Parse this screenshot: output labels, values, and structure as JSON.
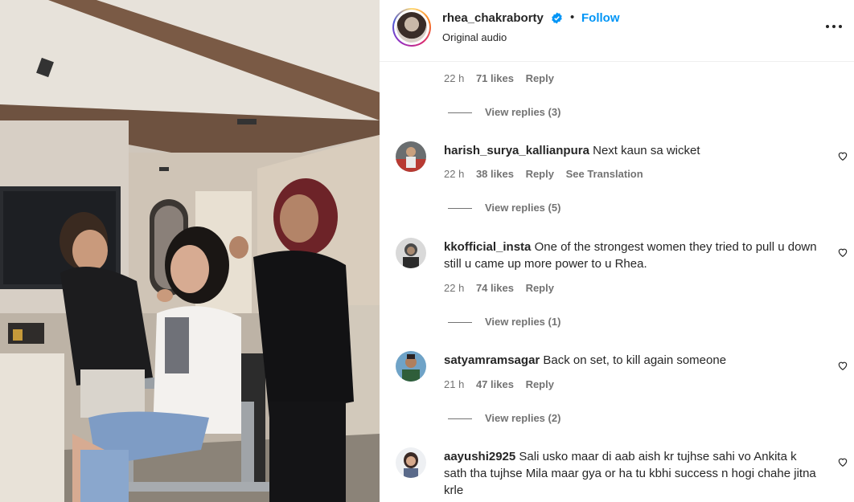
{
  "post": {
    "username": "rhea_chakraborty",
    "follow_label": "Follow",
    "separator": "•",
    "audio": "Original audio",
    "verified_icon": "verified-badge-icon",
    "more_icon": "more-options-icon"
  },
  "top_meta": {
    "time": "22 h",
    "likes": "71 likes",
    "reply": "Reply"
  },
  "top_view_replies": "View replies (3)",
  "comments": [
    {
      "username": "harish_surya_kallianpura",
      "text": "Next kaun sa wicket",
      "time": "22 h",
      "likes": "38 likes",
      "reply": "Reply",
      "translate": "See Translation",
      "view_replies": "View replies (5)"
    },
    {
      "username": "kkofficial_insta",
      "text": "One of the strongest women they tried to pull u down still u came up more power to u Rhea.",
      "time": "22 h",
      "likes": "74 likes",
      "reply": "Reply",
      "view_replies": "View replies (1)"
    },
    {
      "username": "satyamramsagar",
      "text": "Back on set, to kill again someone",
      "time": "21 h",
      "likes": "47 likes",
      "reply": "Reply",
      "view_replies": "View replies (2)"
    },
    {
      "username": "aayushi2925",
      "text": "Sali usko maar di aab aish kr tujhse sahi vo Ankita k sath tha tujhse Mila maar gya or ha tu kbhi success n hogi chahe jitna krle"
    }
  ],
  "colors": {
    "accent": "#0095f6",
    "text": "#262626",
    "muted": "#737373",
    "verified": "#0095f6"
  }
}
